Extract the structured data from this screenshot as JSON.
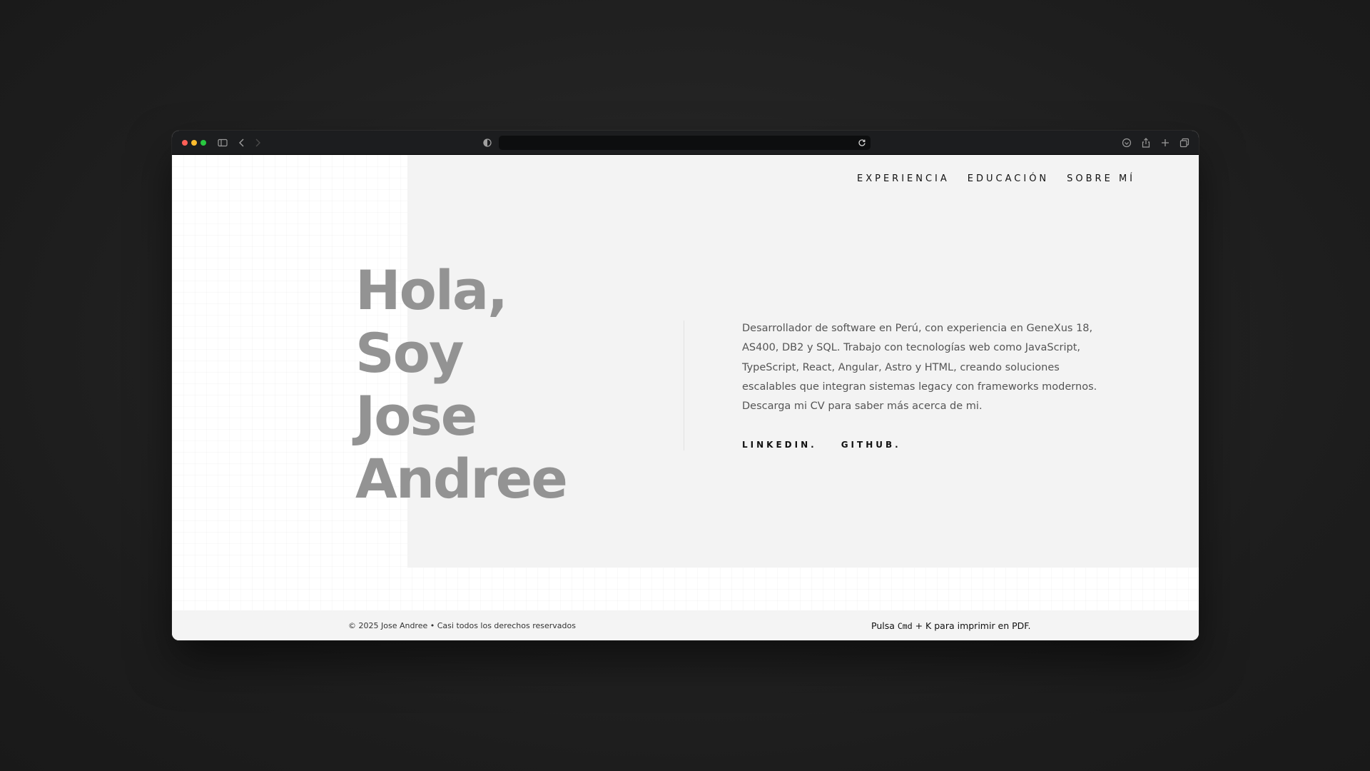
{
  "browser": {
    "icons": {
      "sidebar": "sidebar-icon",
      "back": "chevron-left-icon",
      "forward": "chevron-right-icon",
      "privacy": "shield-icon",
      "reload": "reload-icon",
      "download": "download-icon",
      "share": "share-icon",
      "new_tab": "plus-icon",
      "tabs": "tab-overview-icon"
    },
    "url": ""
  },
  "nav": {
    "items": [
      {
        "label": "EXPERIENCIA"
      },
      {
        "label": "EDUCACIÓN"
      },
      {
        "label": "SOBRE MÍ"
      }
    ]
  },
  "hero": {
    "line1": "Hola,",
    "line2": "Soy",
    "line3": "Jose",
    "line4": "Andree",
    "bio_lines": [
      "Desarrollador de software en Perú, con experiencia en GeneXus 18,",
      "AS400, DB2 y SQL. Trabajo con tecnologías web como JavaScript,",
      "TypeScript, React, Angular, Astro y HTML, creando soluciones",
      "escalables que integran sistemas legacy con frameworks modernos.",
      "Descarga mi CV para saber más acerca de mi."
    ],
    "links": {
      "linkedin": "LINKEDIN.",
      "github": "GITHUB."
    }
  },
  "footer": {
    "copyright": "© 2025 Jose Andree • Casi todos los derechos reservados",
    "print_prefix": "Pulsa ",
    "print_key": "Cmd",
    "print_suffix": " + K para imprimir en PDF."
  },
  "colors": {
    "headline": "#939393",
    "panel": "#f3f3f3",
    "titlebar": "#1c1d1f",
    "backdrop": "#1d1d1d"
  }
}
